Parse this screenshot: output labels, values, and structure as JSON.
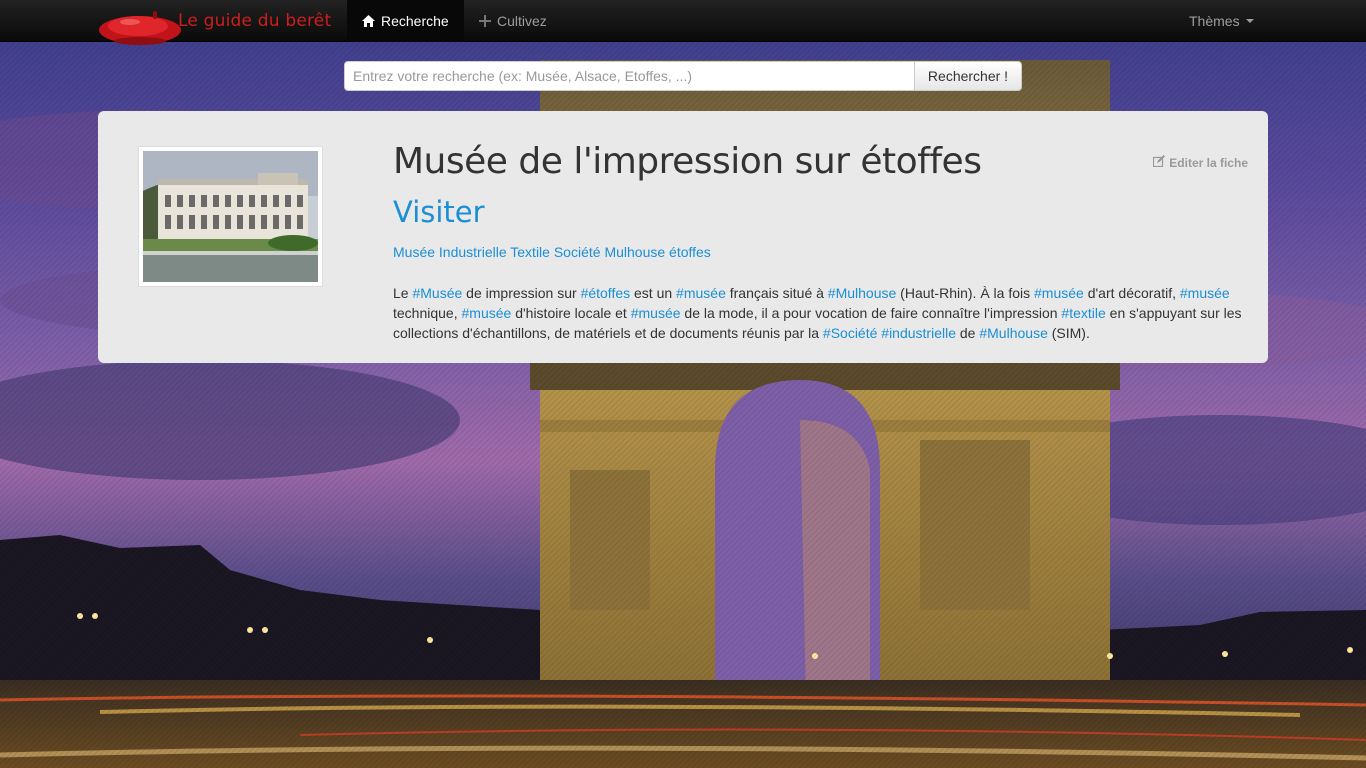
{
  "navbar": {
    "brand": "Le guide du berêt",
    "items": [
      {
        "label": "Recherche",
        "icon": "home-icon",
        "active": true
      },
      {
        "label": "Cultivez",
        "icon": "plus-icon",
        "active": false
      }
    ],
    "themes_label": "Thèmes"
  },
  "search": {
    "placeholder": "Entrez votre recherche (ex: Musée, Alsace, Etoffes, ...)",
    "button_label": "Rechercher !"
  },
  "card": {
    "title": "Musée de l'impression sur étoffes",
    "visit_label": "Visiter",
    "edit_label": "Editer la fiche",
    "tags": [
      "Musée",
      "Industrielle",
      "Textile",
      "Société",
      "Mulhouse",
      "étoffes"
    ],
    "description": [
      {
        "t": "Le "
      },
      {
        "t": "#Musée",
        "link": true
      },
      {
        "t": " de impression sur "
      },
      {
        "t": "#étoffes",
        "link": true
      },
      {
        "t": " est un "
      },
      {
        "t": "#musée",
        "link": true
      },
      {
        "t": " français situé à "
      },
      {
        "t": "#Mulhouse",
        "link": true
      },
      {
        "t": " (Haut-Rhin). À la fois "
      },
      {
        "t": "#musée",
        "link": true
      },
      {
        "t": " d'art décoratif, "
      },
      {
        "t": "#musée",
        "link": true
      },
      {
        "t": " technique, "
      },
      {
        "t": "#musée",
        "link": true
      },
      {
        "t": " d'histoire locale et "
      },
      {
        "t": "#musée",
        "link": true
      },
      {
        "t": " de la mode, il a pour vocation de faire connaître l'impression "
      },
      {
        "t": "#textile",
        "link": true
      },
      {
        "t": " en s'appuyant sur les collections d'échantillons, de matériels et de documents réunis par la "
      },
      {
        "t": "#Société",
        "link": true
      },
      {
        "t": " "
      },
      {
        "t": "#industrielle",
        "link": true
      },
      {
        "t": " de "
      },
      {
        "t": "#Mulhouse",
        "link": true
      },
      {
        "t": " (SIM)."
      }
    ]
  },
  "colors": {
    "brand": "#d01d1d",
    "link": "#1a8fd4",
    "card_bg": "#e9e9e9",
    "navbar_bg": "#111111"
  }
}
